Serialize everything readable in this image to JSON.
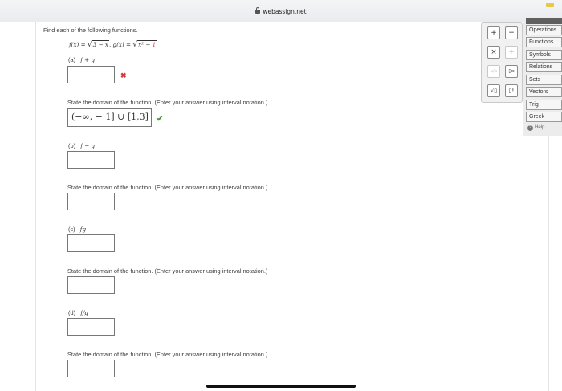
{
  "browser": {
    "url": "webassign.net"
  },
  "problem": {
    "instruction": "Find each of the following functions.",
    "f_label": "f(x) = ",
    "f_radicand": "3 − x",
    "sep": ",  ",
    "g_label": "g(x) = ",
    "g_radicand_main": "x² − ",
    "g_radicand_red": "1"
  },
  "parts": [
    {
      "label": "(a)",
      "expr": "f + g",
      "domain_prompt": "State the domain of the function. (Enter your answer using interval notation.)",
      "function_answer": "",
      "domain_answer": "(−∞, − 1] ∪ [1,3]"
    },
    {
      "label": "(b)",
      "expr": "f − g",
      "domain_prompt": "State the domain of the function. (Enter your answer using interval notation.)",
      "function_answer": "",
      "domain_answer": ""
    },
    {
      "label": "(c)",
      "expr": "fg",
      "domain_prompt": "State the domain of the function. (Enter your answer using interval notation.)",
      "function_answer": "",
      "domain_answer": ""
    },
    {
      "label": "(d)",
      "expr": "f/g",
      "domain_prompt": "State the domain of the function. (Enter your answer using interval notation.)",
      "function_answer": "",
      "domain_answer": ""
    }
  ],
  "feedback": {
    "wrong": "✖",
    "right": "✔"
  },
  "palette": {
    "plus": "+",
    "minus": "−",
    "times": "×",
    "divide": "÷",
    "fraction": "▫/▫",
    "power": "▯▫",
    "sqrt": "√▯",
    "factorial": "▯!"
  },
  "tabs": [
    "Operations",
    "Functions",
    "Symbols",
    "Relations",
    "Sets",
    "Vectors",
    "Trig",
    "Greek"
  ],
  "help_label": "Help"
}
